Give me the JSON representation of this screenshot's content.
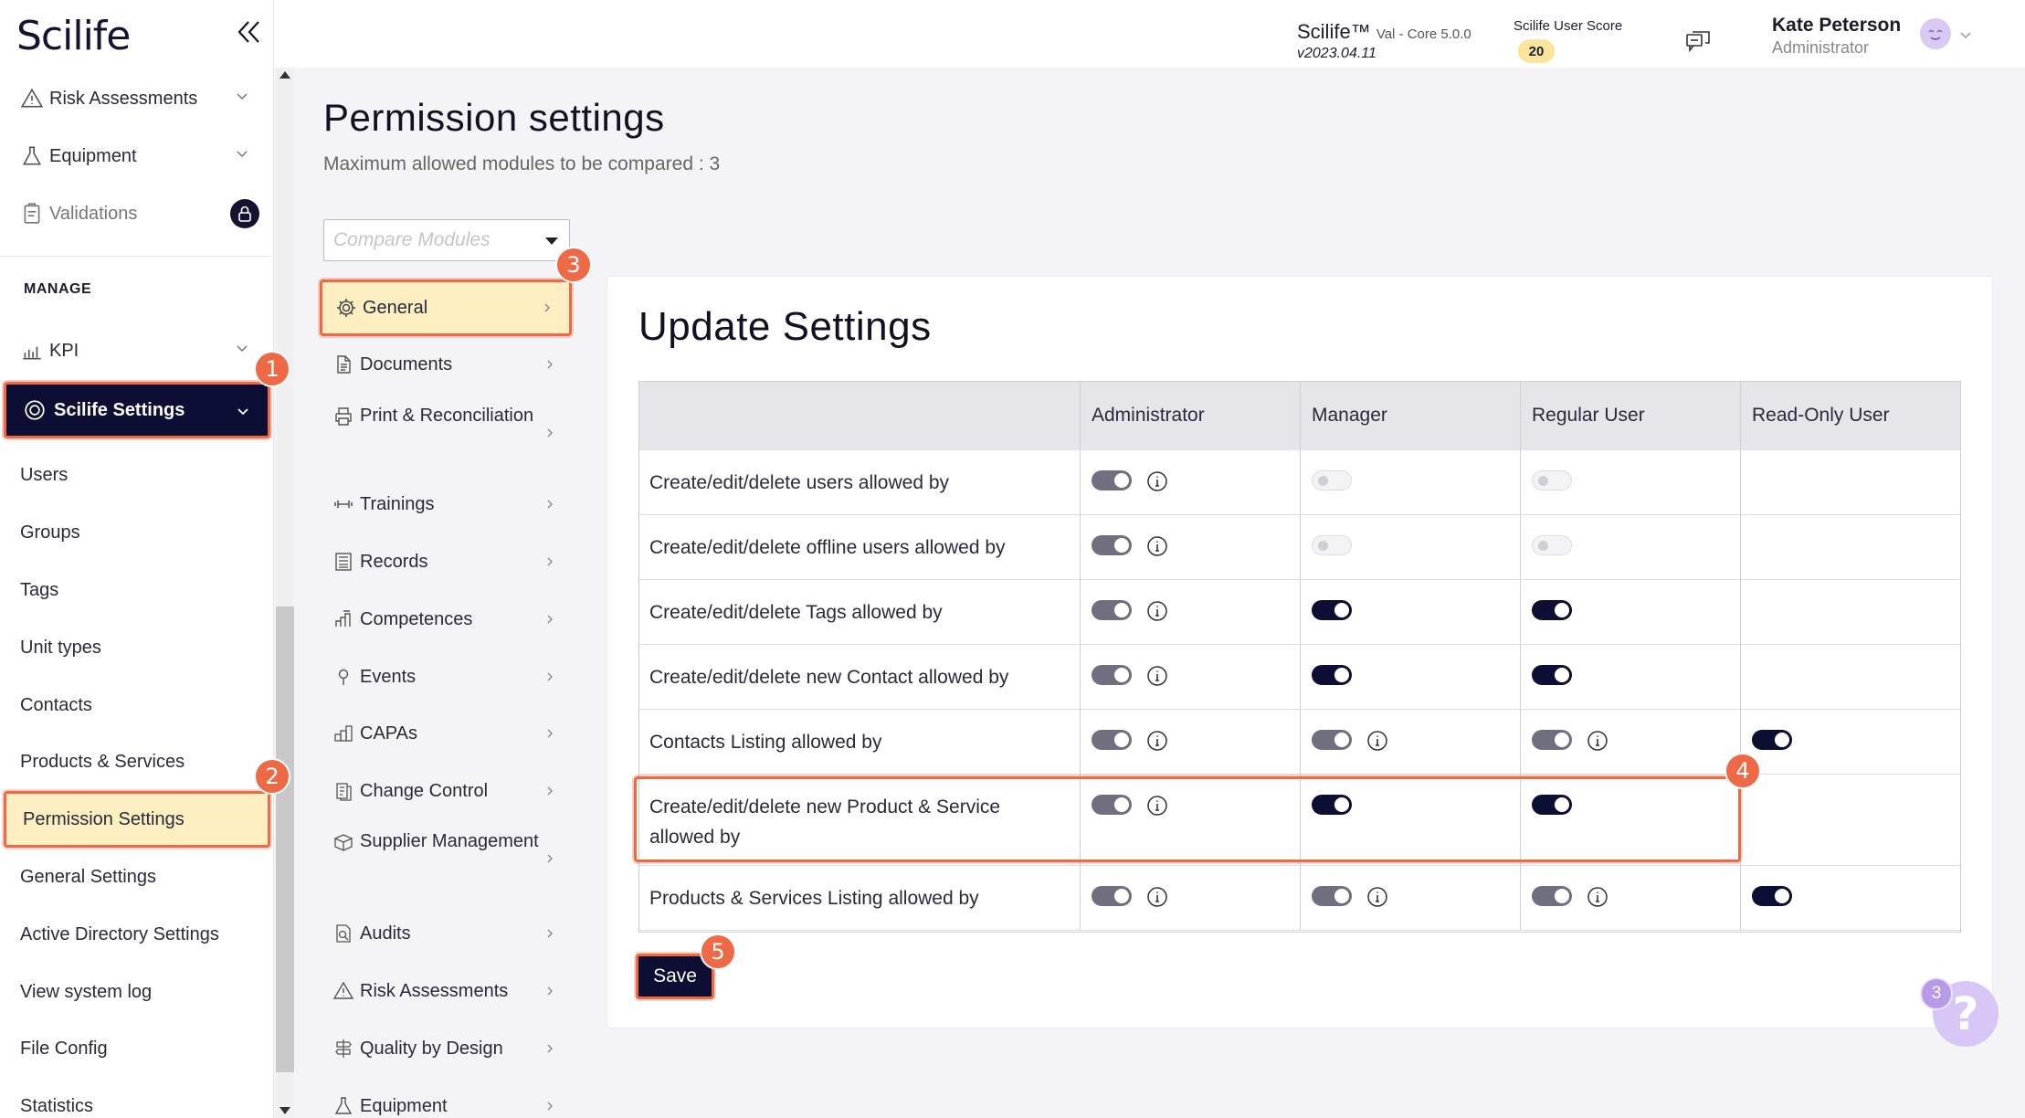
{
  "app": {
    "logo": "Scilife",
    "version_name": "Scilife™",
    "version_detail": "Val - Core 5.0.0",
    "version_number": "v2023.04.11",
    "score_label": "Scilife User Score",
    "score_value": "20",
    "user_name": "Kate Peterson",
    "user_role": "Administrator"
  },
  "sidebar": {
    "top_items": [
      {
        "label": "Risk Assessments",
        "icon": "warning-icon"
      },
      {
        "label": "Equipment",
        "icon": "flask-icon"
      },
      {
        "label": "Validations",
        "icon": "clipboard-icon"
      }
    ],
    "manage_heading": "MANAGE",
    "kpi_label": "KPI",
    "settings_label": "Scilife Settings",
    "items": [
      {
        "label": "Users"
      },
      {
        "label": "Groups"
      },
      {
        "label": "Tags"
      },
      {
        "label": "Unit types"
      },
      {
        "label": "Contacts"
      },
      {
        "label": "Products & Services"
      },
      {
        "label": "Permission Settings"
      },
      {
        "label": "General Settings"
      },
      {
        "label": "Active Directory Settings"
      },
      {
        "label": "View system log"
      },
      {
        "label": "File Config"
      },
      {
        "label": "Statistics"
      }
    ]
  },
  "page": {
    "title": "Permission settings",
    "subtitle": "Maximum allowed modules to be compared : 3",
    "compare_placeholder": "Compare Modules"
  },
  "modules": [
    {
      "label": "General",
      "icon": "gear-icon"
    },
    {
      "label": "Documents",
      "icon": "document-icon"
    },
    {
      "label": "Print & Reconciliation",
      "icon": "printer-icon"
    },
    {
      "label": "Trainings",
      "icon": "dumbbell-icon"
    },
    {
      "label": "Records",
      "icon": "records-icon"
    },
    {
      "label": "Competences",
      "icon": "competence-icon"
    },
    {
      "label": "Events",
      "icon": "pin-icon"
    },
    {
      "label": "CAPAs",
      "icon": "capa-icon"
    },
    {
      "label": "Change Control",
      "icon": "change-icon"
    },
    {
      "label": "Supplier Management",
      "icon": "box-icon"
    },
    {
      "label": "Audits",
      "icon": "audit-icon"
    },
    {
      "label": "Risk Assessments",
      "icon": "warning-icon"
    },
    {
      "label": "Quality by Design",
      "icon": "signpost-icon"
    },
    {
      "label": "Equipment",
      "icon": "flask-icon"
    }
  ],
  "card": {
    "title": "Update Settings",
    "columns": [
      "",
      "Administrator",
      "Manager",
      "Regular User",
      "Read-Only User"
    ],
    "rows": [
      {
        "label": "Create/edit/delete users allowed by",
        "cells": [
          {
            "state": "grey",
            "info": true
          },
          {
            "state": "off",
            "info": false
          },
          {
            "state": "off",
            "info": false
          },
          {
            "state": "none",
            "info": false
          }
        ]
      },
      {
        "label": "Create/edit/delete offline users allowed by",
        "cells": [
          {
            "state": "grey",
            "info": true
          },
          {
            "state": "off",
            "info": false
          },
          {
            "state": "off",
            "info": false
          },
          {
            "state": "none",
            "info": false
          }
        ]
      },
      {
        "label": "Create/edit/delete Tags allowed by",
        "cells": [
          {
            "state": "grey",
            "info": true
          },
          {
            "state": "dark",
            "info": false
          },
          {
            "state": "dark",
            "info": false
          },
          {
            "state": "none",
            "info": false
          }
        ]
      },
      {
        "label": "Create/edit/delete new Contact allowed by",
        "cells": [
          {
            "state": "grey",
            "info": true
          },
          {
            "state": "dark",
            "info": false
          },
          {
            "state": "dark",
            "info": false
          },
          {
            "state": "none",
            "info": false
          }
        ]
      },
      {
        "label": "Contacts Listing allowed by",
        "cells": [
          {
            "state": "grey",
            "info": true
          },
          {
            "state": "grey",
            "info": true
          },
          {
            "state": "grey",
            "info": true
          },
          {
            "state": "dark",
            "info": false
          }
        ]
      },
      {
        "label": "Create/edit/delete new Product & Service allowed by",
        "cells": [
          {
            "state": "grey",
            "info": true
          },
          {
            "state": "dark",
            "info": false
          },
          {
            "state": "dark",
            "info": false
          },
          {
            "state": "none",
            "info": false
          }
        ]
      },
      {
        "label": "Products & Services Listing allowed by",
        "cells": [
          {
            "state": "grey",
            "info": true
          },
          {
            "state": "grey",
            "info": true
          },
          {
            "state": "grey",
            "info": true
          },
          {
            "state": "dark",
            "info": false
          }
        ]
      }
    ],
    "save_label": "Save"
  },
  "steps": [
    "1",
    "2",
    "3",
    "4",
    "5"
  ],
  "help": {
    "count": "3",
    "symbol": "?"
  },
  "colors": {
    "navy": "#0d0e33",
    "highlight": "#fdefc2",
    "accent": "#ee6a47",
    "toggle_grey": "#6f6f80"
  }
}
